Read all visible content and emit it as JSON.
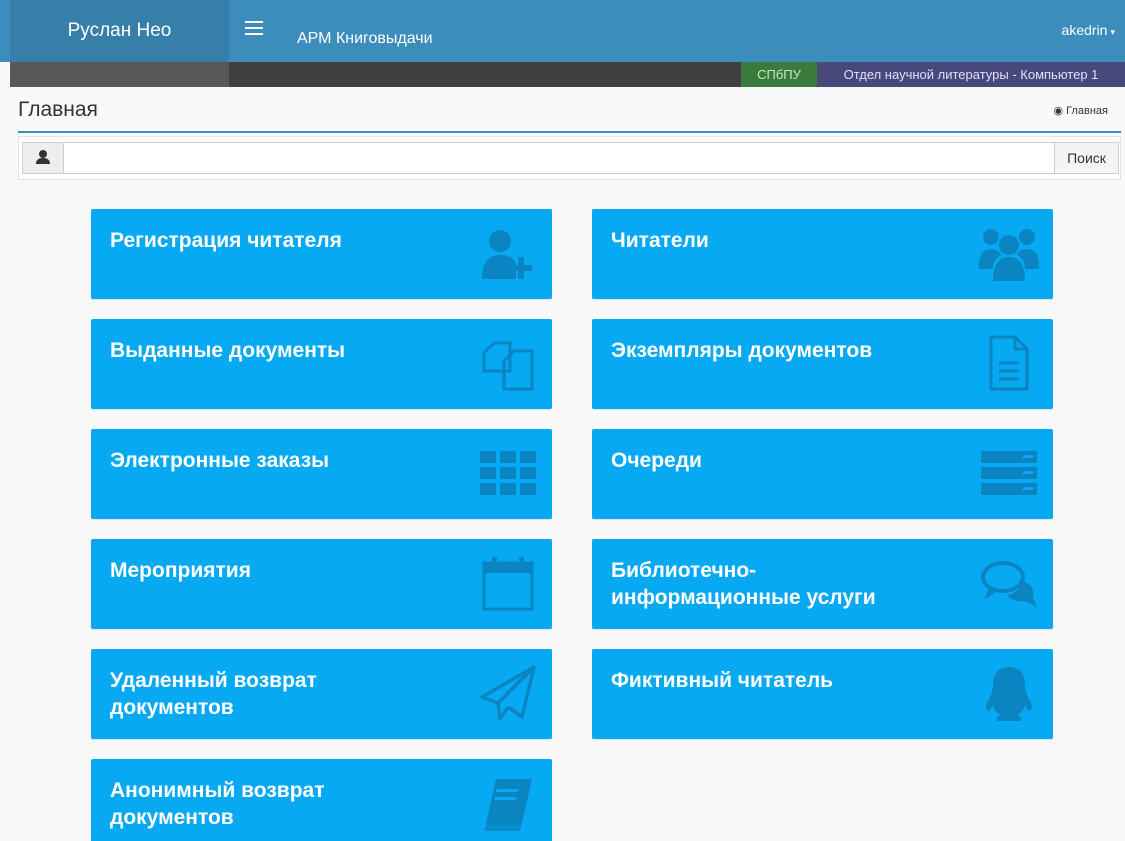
{
  "header": {
    "brand": "Руслан Нео",
    "app_title": "АРМ Книговыдачи",
    "user": "akedrin",
    "caret": "▾"
  },
  "subbar": {
    "org": "СПбПУ",
    "department": "Отдел научной литературы - Компьютер 1"
  },
  "page": {
    "title": "Главная",
    "breadcrumb": "Главная",
    "breadcrumb_icon": "dashboard-icon"
  },
  "search": {
    "value": "",
    "placeholder": "",
    "button_label": "Поиск",
    "addon_icon": "user-icon"
  },
  "colors": {
    "navbar": "#3c8dbc",
    "brand": "#367fa9",
    "tile": "#08a9f3",
    "tile_icon": "#0a85c2"
  },
  "tiles": [
    {
      "label": "Регистрация читателя",
      "icon": "user-plus-icon"
    },
    {
      "label": "Читатели",
      "icon": "users-icon"
    },
    {
      "label": "Выданные документы",
      "icon": "copy-icon"
    },
    {
      "label": "Экземпляры документов",
      "icon": "file-text-icon"
    },
    {
      "label": "Электронные заказы",
      "icon": "grid-icon"
    },
    {
      "label": "Очереди",
      "icon": "server-icon"
    },
    {
      "label": "Мероприятия",
      "icon": "calendar-icon"
    },
    {
      "label": "Библиотечно-информационные услуги",
      "icon": "comments-icon"
    },
    {
      "label": "Удаленный возврат документов",
      "icon": "paper-plane-icon"
    },
    {
      "label": "Фиктивный читатель",
      "icon": "qq-icon"
    },
    {
      "label": "Анонимный возврат документов",
      "icon": "book-icon"
    }
  ]
}
